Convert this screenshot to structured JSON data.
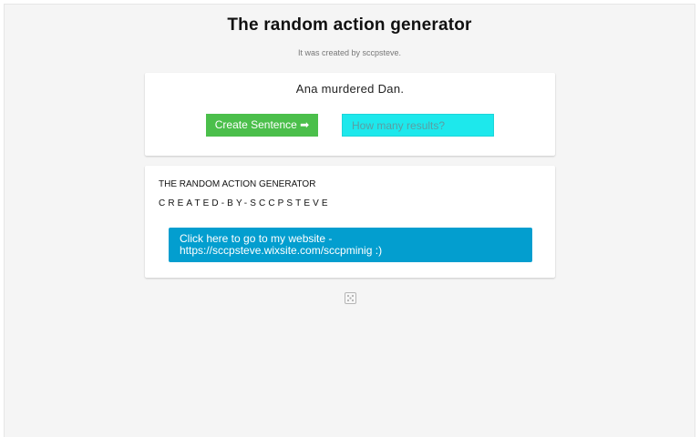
{
  "header": {
    "title": "The random action generator",
    "subtitle": "It was created by sccpsteve."
  },
  "generator": {
    "sentence": "Ana murdered Dan.",
    "create_button_label": "Create Sentence ➡",
    "results_input_value": "",
    "results_input_placeholder": "How many results?"
  },
  "info": {
    "heading": "THE RANDOM ACTION GENERATOR",
    "credit": "CREATED-BY-SCCPSTEVE",
    "website_button_label": "Click here to go to my website - https://sccpsteve.wixsite.com/sccpminig :)"
  },
  "icons": {
    "footer_icon": "dice-icon"
  },
  "colors": {
    "create_button": "#4bbf4b",
    "results_input": "#1de8ec",
    "website_button": "#039ecf",
    "page_background": "#f5f5f5"
  }
}
